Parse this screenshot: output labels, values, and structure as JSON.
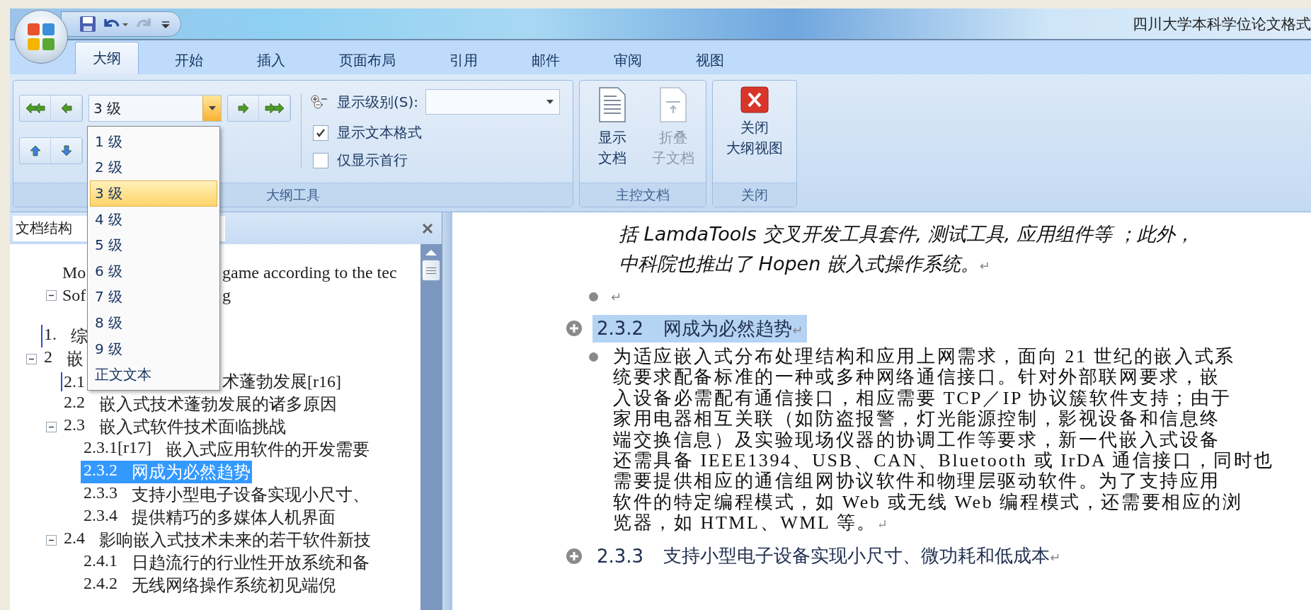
{
  "window": {
    "title": "四川大学本科学位论文格式"
  },
  "quick_access": [
    {
      "kind": "save",
      "disabled": false
    },
    {
      "kind": "undo",
      "disabled": false
    },
    {
      "kind": "redo",
      "disabled": true
    }
  ],
  "tabs": [
    {
      "label": "大纲",
      "selected": true
    },
    {
      "label": "开始",
      "selected": false
    },
    {
      "label": "插入",
      "selected": false
    },
    {
      "label": "页面布局",
      "selected": false
    },
    {
      "label": "引用",
      "selected": false
    },
    {
      "label": "邮件",
      "selected": false
    },
    {
      "label": "审阅",
      "selected": false
    },
    {
      "label": "视图",
      "selected": false
    }
  ],
  "outline_group": {
    "label": "大纲工具",
    "level_box": {
      "value": "3 级",
      "open": true
    },
    "show_level": {
      "label": "显示级别(S):"
    },
    "checkboxes": [
      {
        "label": "显示文本格式",
        "checked": true
      },
      {
        "label": "仅显示首行",
        "checked": false
      }
    ]
  },
  "master_group": {
    "label": "主控文档",
    "buttons": [
      {
        "lines": [
          "显示",
          "文档"
        ],
        "disabled": false
      },
      {
        "lines": [
          "折叠",
          "子文档"
        ],
        "disabled": true
      }
    ]
  },
  "close_group": {
    "label": "关闭",
    "button": {
      "lines": [
        "关闭",
        "大纲视图"
      ]
    }
  },
  "level_menu": [
    {
      "label": "1 级",
      "selected": false
    },
    {
      "label": "2 级",
      "selected": false
    },
    {
      "label": "3 级",
      "selected": true
    },
    {
      "label": "4 级",
      "selected": false
    },
    {
      "label": "5 级",
      "selected": false
    },
    {
      "label": "6 级",
      "selected": false
    },
    {
      "label": "7 级",
      "selected": false
    },
    {
      "label": "8 级",
      "selected": false
    },
    {
      "label": "9 级",
      "selected": false
    },
    {
      "label": "正文文本",
      "selected": false
    }
  ],
  "nav_pane": {
    "title": "文档结构",
    "continued": [
      {
        "number": "Mo",
        "text": "game according to the tec",
        "split": true,
        "selected": false
      },
      {
        "number": "Sof",
        "text": "g",
        "split": true,
        "expanded": true,
        "selected": false
      }
    ],
    "tree": [
      {
        "number": "1.",
        "text": "综",
        "marker": true,
        "selected": false
      },
      {
        "number": "2",
        "text": "嵌",
        "expanded": true,
        "selected": false,
        "children": [
          {
            "number": "2.1",
            "text": "术蓬勃发展[r16]",
            "split": true,
            "marker": true,
            "selected": false
          },
          {
            "number": "2.2",
            "text": "嵌入式技术蓬勃发展的诸多原因",
            "selected": false
          },
          {
            "number": "2.3",
            "text": "嵌入式软件技术面临挑战",
            "expanded": true,
            "selected": false,
            "children": [
              {
                "number": "2.3.1[r17]",
                "text": "嵌入式应用软件的开发需要",
                "selected": false
              },
              {
                "number": "2.3.2",
                "text": "网成为必然趋势",
                "selected": true
              },
              {
                "number": "2.3.3",
                "text": "支持小型电子设备实现小尺寸、",
                "selected": false
              },
              {
                "number": "2.3.4",
                "text": "提供精巧的多媒体人机界面",
                "selected": false
              }
            ]
          },
          {
            "number": "2.4",
            "text": "影响嵌入式技术未来的若干软件新技",
            "expanded": true,
            "selected": false,
            "children": [
              {
                "number": "2.4.1",
                "text": "日趋流行的行业性开放系统和备",
                "selected": false
              },
              {
                "number": "2.4.2",
                "text": "无线网络操作系统初见端倪",
                "selected": false
              }
            ]
          }
        ]
      }
    ]
  },
  "document": {
    "blocks": [
      {
        "kind": "italic",
        "lines": [
          "括 LamdaTools 交叉开发工具套件, 测试工具, 应用组件等 ；此外，",
          "中科院也推出了 Hopen 嵌入式操作系统。"
        ],
        "end_mark": "↵"
      },
      {
        "kind": "empty",
        "end_mark": "↵"
      },
      {
        "kind": "heading",
        "number": "2.3.2",
        "text": "网成为必然趋势",
        "selected": true,
        "end_mark": "↵"
      },
      {
        "kind": "body",
        "lines": [
          "为适应嵌入式分布处理结构和应用上网需求，面向 21 世纪的嵌入式系",
          "统要求配备标准的一种或多种网络通信接口。针对外部联网要求，嵌",
          "入设备必需配有通信接口，相应需要 TCP／IP 协议簇软件支持；由于",
          "家用电器相互关联（如防盗报警，灯光能源控制，影视设备和信息终",
          "端交换信息）及实验现场仪器的协调工作等要求，新一代嵌入式设备",
          "还需具备 IEEE1394、USB、CAN、Bluetooth 或 IrDA 通信接口，同时也",
          "需要提供相应的通信组网协议软件和物理层驱动软件。为了支持应用",
          "软件的特定编程模式，如 Web 或无线 Web 编程模式，还需要相应的浏",
          "览器，如 HTML、WML 等。"
        ],
        "end_mark": "↵"
      },
      {
        "kind": "heading",
        "number": "2.3.3",
        "text": "支持小型电子设备实现小尺寸、微功耗和低成本",
        "selected": false,
        "end_mark": "↵"
      }
    ]
  }
}
